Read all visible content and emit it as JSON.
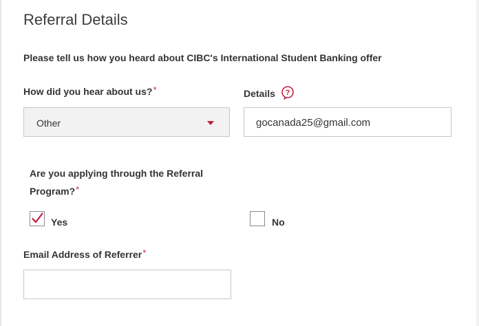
{
  "section": {
    "title": "Referral Details",
    "lead": "Please tell us how you heard about CIBC's International Student Banking offer"
  },
  "heard_about": {
    "label": "How did you hear about us?",
    "required_mark": "*",
    "selected": "Other"
  },
  "details": {
    "label": "Details",
    "value": "gocanada25@gmail.com"
  },
  "referral_program": {
    "question": "Are you applying through the Referral Program?",
    "required_mark": "*",
    "options": [
      {
        "label": "Yes",
        "checked": true
      },
      {
        "label": "No",
        "checked": false
      }
    ]
  },
  "referrer_email": {
    "label": "Email Address of Referrer",
    "required_mark": "*",
    "value": ""
  },
  "colors": {
    "accent": "#c41f3e",
    "text": "#333333",
    "field_border": "#c6c6c6",
    "select_bg": "#f2f2f2"
  },
  "icons": {
    "help": "help-icon",
    "dropdown": "chevron-down-icon",
    "check": "check-icon"
  }
}
